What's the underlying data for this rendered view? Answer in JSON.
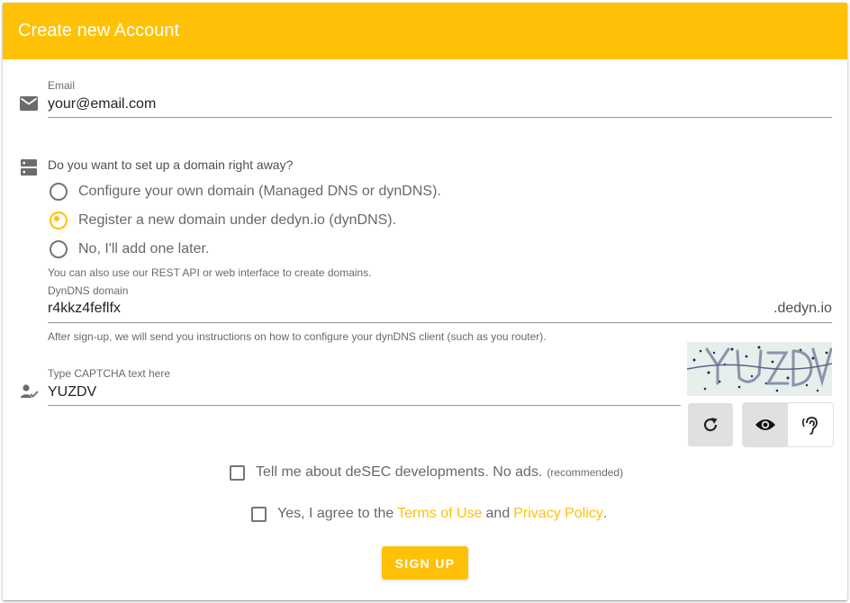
{
  "header": {
    "title": "Create new Account"
  },
  "colors": {
    "accent": "#ffc107",
    "text": "#212121",
    "muted": "#757575"
  },
  "email": {
    "label": "Email",
    "value": "your@email.com",
    "icon": "email-icon"
  },
  "domain_setup": {
    "question": "Do you want to set up a domain right away?",
    "icon": "dns-server-icon",
    "options": [
      {
        "label": "Configure your own domain (Managed DNS or dynDNS).",
        "selected": false
      },
      {
        "label": "Register a new domain under dedyn.io (dynDNS).",
        "selected": true
      },
      {
        "label": "No, I'll add one later.",
        "selected": false
      }
    ],
    "hint": "You can also use our REST API or web interface to create domains."
  },
  "dyndns": {
    "label": "DynDNS domain",
    "value": "r4kkz4feflfx",
    "suffix": ".dedyn.io",
    "hint": "After sign-up, we will send you instructions on how to configure your dynDNS client (such as you router)."
  },
  "captcha": {
    "label": "Type CAPTCHA text here",
    "value": "YUZDV",
    "icon": "account-check-icon",
    "refresh_icon": "refresh-icon",
    "visual_icon": "eye-icon",
    "audio_icon": "ear-hearing-icon"
  },
  "newsletter": {
    "label": "Tell me about deSEC developments. No ads.",
    "note": "(recommended)",
    "checked": false
  },
  "terms": {
    "prefix": "Yes, I agree to the",
    "terms_link": "Terms of Use",
    "middle": "and",
    "privacy_link": "Privacy Policy",
    "suffix": ".",
    "checked": false
  },
  "signup_button": {
    "label": "SIGN UP"
  }
}
